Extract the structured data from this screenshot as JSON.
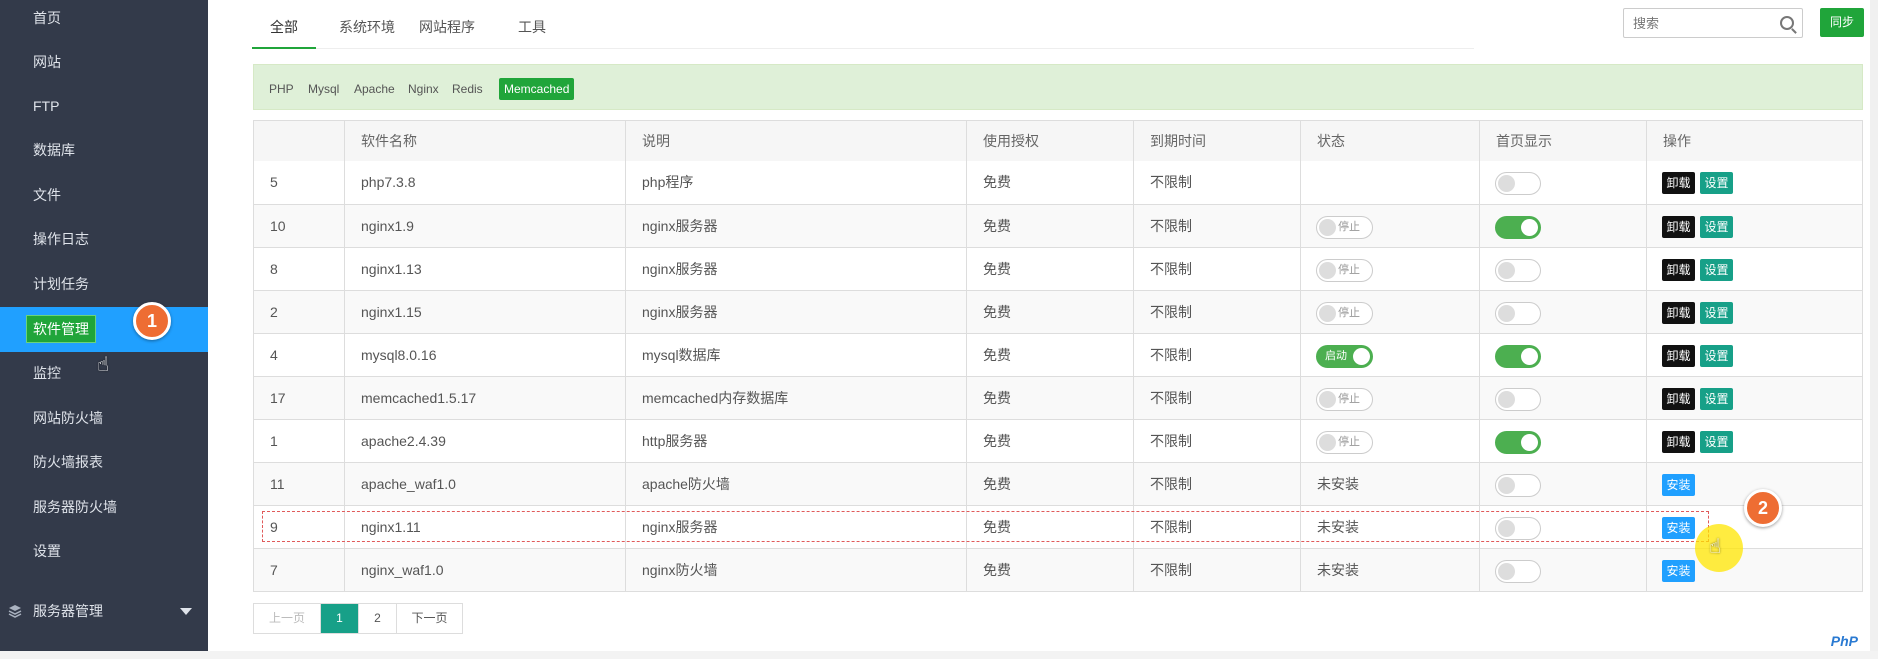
{
  "sidebar": {
    "items": [
      {
        "label": "首页"
      },
      {
        "label": "网站"
      },
      {
        "label": "FTP"
      },
      {
        "label": "数据库"
      },
      {
        "label": "文件"
      },
      {
        "label": "操作日志"
      },
      {
        "label": "计划任务"
      },
      {
        "label": "软件管理"
      },
      {
        "label": "监控"
      },
      {
        "label": "网站防火墙"
      },
      {
        "label": "防火墙报表"
      },
      {
        "label": "服务器防火墙"
      },
      {
        "label": "设置"
      }
    ],
    "active_index": 7,
    "server_mgmt_label": "服务器管理"
  },
  "callouts": {
    "one": "1",
    "two": "2"
  },
  "tabs": [
    {
      "label": "全部",
      "active": true
    },
    {
      "label": "系统环境"
    },
    {
      "label": "网站程序"
    },
    {
      "label": "工具"
    }
  ],
  "search": {
    "placeholder": "搜索"
  },
  "sync_label": "同步",
  "filters": [
    {
      "label": "PHP"
    },
    {
      "label": "Mysql"
    },
    {
      "label": "Apache"
    },
    {
      "label": "Nginx"
    },
    {
      "label": "Redis"
    },
    {
      "label": "Memcached",
      "active": true
    }
  ],
  "table": {
    "headers": [
      "",
      "软件名称",
      "说明",
      "使用授权",
      "到期时间",
      "状态",
      "首页显示",
      "操作"
    ],
    "rows": [
      {
        "id": "5",
        "name": "php7.3.8",
        "desc": "php程序",
        "license": "免费",
        "expiry": "不限制",
        "status": "",
        "home": false,
        "actions": [
          "卸载",
          "设置"
        ]
      },
      {
        "id": "10",
        "name": "nginx1.9",
        "desc": "nginx服务器",
        "license": "免费",
        "expiry": "不限制",
        "status": "停止",
        "home": true,
        "actions": [
          "卸载",
          "设置"
        ]
      },
      {
        "id": "8",
        "name": "nginx1.13",
        "desc": "nginx服务器",
        "license": "免费",
        "expiry": "不限制",
        "status": "停止",
        "home": false,
        "actions": [
          "卸载",
          "设置"
        ]
      },
      {
        "id": "2",
        "name": "nginx1.15",
        "desc": "nginx服务器",
        "license": "免费",
        "expiry": "不限制",
        "status": "停止",
        "home": false,
        "actions": [
          "卸载",
          "设置"
        ]
      },
      {
        "id": "4",
        "name": "mysql8.0.16",
        "desc": "mysql数据库",
        "license": "免费",
        "expiry": "不限制",
        "status": "启动",
        "home": true,
        "actions": [
          "卸载",
          "设置"
        ]
      },
      {
        "id": "17",
        "name": "memcached1.5.17",
        "desc": "memcached内存数据库",
        "license": "免费",
        "expiry": "不限制",
        "status": "停止",
        "home": false,
        "actions": [
          "卸载",
          "设置"
        ]
      },
      {
        "id": "1",
        "name": "apache2.4.39",
        "desc": "http服务器",
        "license": "免费",
        "expiry": "不限制",
        "status": "停止",
        "home": true,
        "actions": [
          "卸载",
          "设置"
        ]
      },
      {
        "id": "11",
        "name": "apache_waf1.0",
        "desc": "apache防火墙",
        "license": "免费",
        "expiry": "不限制",
        "status": "未安装",
        "home": false,
        "actions": [
          "安装"
        ]
      },
      {
        "id": "9",
        "name": "nginx1.11",
        "desc": "nginx服务器",
        "license": "免费",
        "expiry": "不限制",
        "status": "未安装",
        "home": false,
        "actions": [
          "安装"
        ]
      },
      {
        "id": "7",
        "name": "nginx_waf1.0",
        "desc": "nginx防火墙",
        "license": "免费",
        "expiry": "不限制",
        "status": "未安装",
        "home": false,
        "actions": [
          "安装"
        ]
      }
    ]
  },
  "pagination": {
    "prev": "上一页",
    "pages": [
      "1",
      "2"
    ],
    "current": "1",
    "next": "下一页"
  },
  "watermark": "PhP",
  "colors": {
    "sidebar_bg": "#333a4a",
    "active_nav": "#20a0ff",
    "brand_green": "#20a53a",
    "teal": "#17a088",
    "install_blue": "#20a0ff"
  }
}
